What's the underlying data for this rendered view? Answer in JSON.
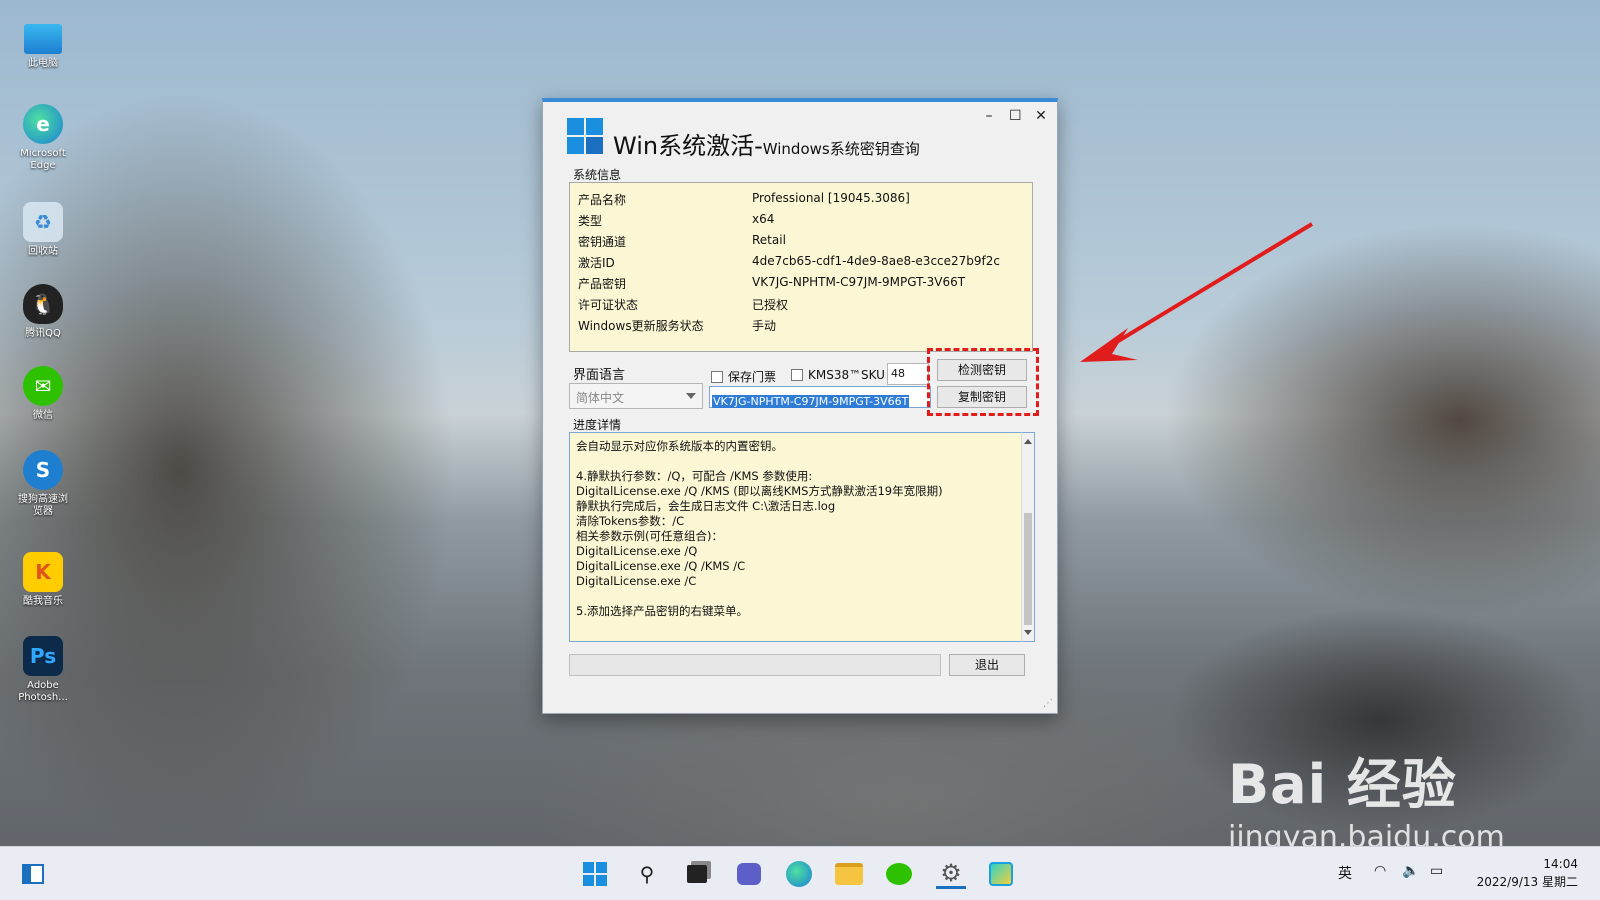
{
  "desktop": {
    "icons": [
      {
        "label": "此电脑",
        "icon": "monitor-icon"
      },
      {
        "label": "Microsoft Edge",
        "icon": "edge-icon"
      },
      {
        "label": "回收站",
        "icon": "recycle-bin-icon"
      },
      {
        "label": "腾讯QQ",
        "icon": "qq-penguin-icon"
      },
      {
        "label": "微信",
        "icon": "wechat-icon"
      },
      {
        "label": "搜狗高速浏览器",
        "icon": "sogou-browser-icon"
      },
      {
        "label": "酷我音乐",
        "icon": "kuwo-music-icon"
      },
      {
        "label": "Adobe Photosh...",
        "icon": "photoshop-icon"
      }
    ]
  },
  "window": {
    "title_main": "Win系统激活-",
    "title_sub": "Windows系统密钥查询",
    "controls": {
      "minimize": "–",
      "maximize": "☐",
      "close": "✕"
    },
    "system_info_label": "系统信息",
    "info": [
      {
        "key": "产品名称",
        "value": "Professional [19045.3086]"
      },
      {
        "key": "类型",
        "value": "x64"
      },
      {
        "key": "密钥通道",
        "value": "Retail"
      },
      {
        "key": "激活ID",
        "value": "4de7cb65-cdf1-4de9-8ae8-e3cce27b9f2c"
      },
      {
        "key": "产品密钥",
        "value": "VK7JG-NPHTM-C97JM-9MPGT-3V66T"
      },
      {
        "key": "许可证状态",
        "value": "已授权"
      },
      {
        "key": "Windows更新服务状态",
        "value": "手动"
      }
    ],
    "language_label": "界面语言",
    "language_value": "简体中文",
    "keep_ticket_label": "保存门票",
    "kms38_label": "KMS38™",
    "sku_label": "SKU",
    "sku_value": "48",
    "key_field_value": "VK7JG-NPHTM-C97JM-9MPGT-3V66T",
    "check_key_button": "检测密钥",
    "copy_key_button": "复制密钥",
    "details_label": "进度详情",
    "details_lines": [
      "会自动显示对应你系统版本的内置密钥。",
      "",
      "4.静默执行参数：/Q，可配合 /KMS 参数使用:",
      "DigitalLicense.exe /Q /KMS (即以离线KMS方式静默激活19年宽限期)",
      "静默执行完成后，会生成日志文件 C:\\激活日志.log",
      "清除Tokens参数：/C",
      "相关参数示例(可任意组合)：",
      "DigitalLicense.exe /Q",
      "DigitalLicense.exe /Q /KMS /C",
      "DigitalLicense.exe /C",
      "",
      "5.添加选择产品密钥的右键菜单。"
    ],
    "exit_button": "退出"
  },
  "annotation": {
    "highlight_color": "#e01c1c",
    "arrow_color": "#e01c1c"
  },
  "watermark": {
    "main": "Bai  经验",
    "sub": "jingyan.baidu.com"
  },
  "taskbar": {
    "icons": [
      "widgets-icon",
      "start-icon",
      "search-icon",
      "task-view-icon",
      "chat-icon",
      "edge-icon",
      "file-explorer-icon",
      "wechat-icon",
      "settings-icon",
      "paint-icon"
    ],
    "ime": "英",
    "time": "14:04",
    "date": "2022/9/13 星期二"
  }
}
